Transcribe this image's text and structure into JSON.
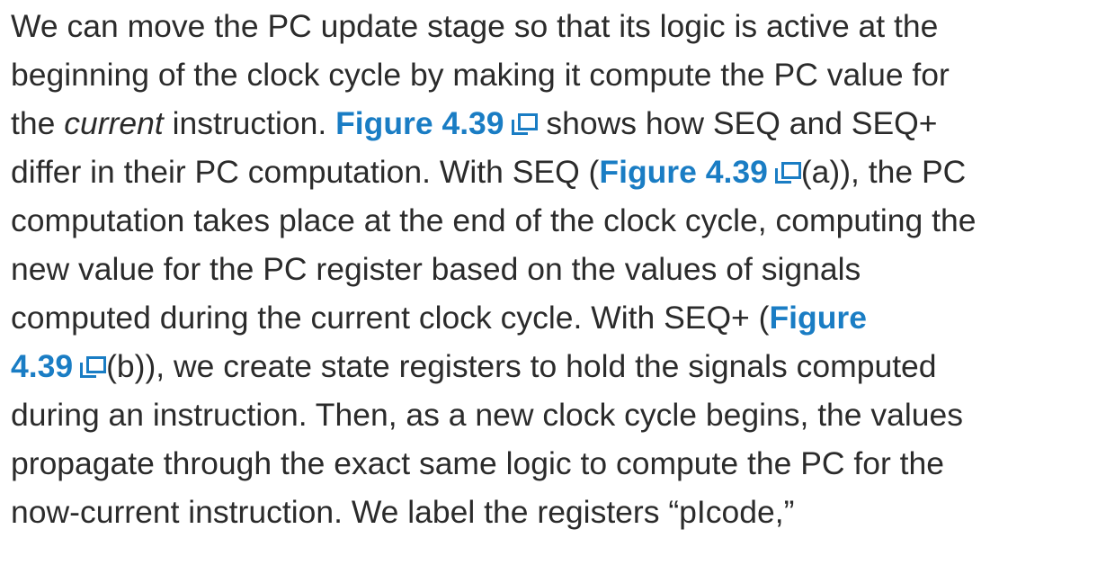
{
  "paragraph": {
    "l1": "We can move the PC update stage so that its logic is active at the",
    "l2": "beginning of the clock cycle by making it compute the PC value for",
    "l3a": "the ",
    "l3_em": "current",
    "l3b": " instruction. ",
    "l3_link": "Figure 4.39",
    "l3c": " shows how SEQ and SEQ+",
    "l4a": "differ in their PC computation. With SEQ (",
    "l4_link": "Figure 4.39",
    "l4b": "(a)), the PC",
    "l5": "computation takes place at the end of the clock cycle, computing the",
    "l6": "new value for the PC register based on the values of signals",
    "l7a": "computed during the current clock cycle. With SEQ+ (",
    "l7_link": "Figure",
    "l8_link": "4.39",
    "l8b": "(b)), we create state registers to hold the signals computed",
    "l9": "during an instruction. Then, as a new clock cycle begins, the values",
    "l10": "propagate through the exact same logic to compute the PC for the",
    "l11": "now-current instruction. We label the registers “pIcode,”"
  },
  "icons": {
    "figure_link_icon": "external-window-icon"
  },
  "colors": {
    "link": "#1a7dc4",
    "text": "#2b2b2b"
  }
}
